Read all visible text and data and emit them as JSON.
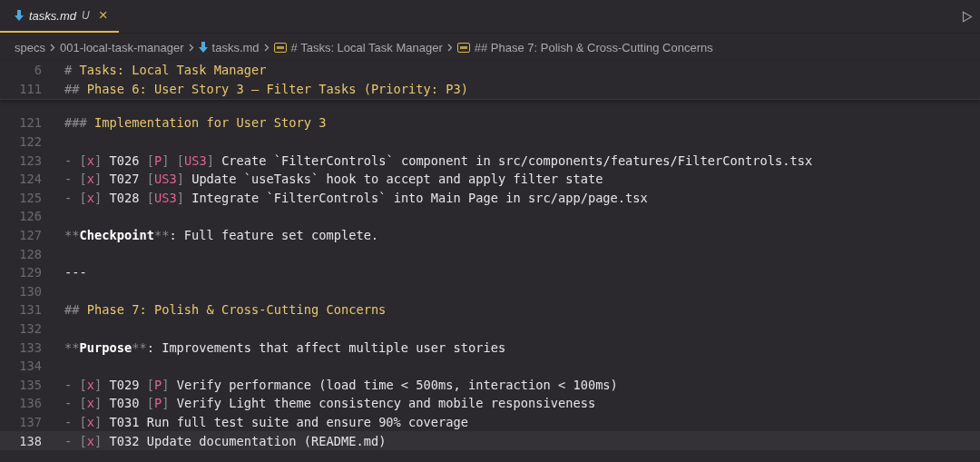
{
  "tabs": [
    {
      "label": "tasks.md",
      "status": "U",
      "close": "×",
      "selected": true
    }
  ],
  "breadcrumbs": [
    {
      "label": "specs",
      "kind": "folder"
    },
    {
      "label": "001-local-task-manager",
      "kind": "folder"
    },
    {
      "label": "tasks.md",
      "kind": "markdown"
    },
    {
      "label": "# Tasks: Local Task Manager",
      "kind": "symbol"
    },
    {
      "label": "## Phase 7: Polish & Cross-Cutting Concerns",
      "kind": "symbol"
    }
  ],
  "sticky_lines": [
    {
      "number": "6",
      "segments": [
        {
          "text": "# ",
          "kind": "muted"
        },
        {
          "text": "Tasks: Local Task Manager",
          "kind": "heading"
        }
      ]
    },
    {
      "number": "111",
      "segments": [
        {
          "text": "## ",
          "kind": "muted"
        },
        {
          "text": "Phase 6: User Story 3 – Filter Tasks (Priority: P3)",
          "kind": "heading"
        }
      ]
    }
  ],
  "lines": [
    {
      "number": "121",
      "current": false,
      "segments": [
        {
          "text": "### ",
          "kind": "muted"
        },
        {
          "text": "Implementation for User Story 3",
          "kind": "heading"
        }
      ]
    },
    {
      "number": "122",
      "current": false
    },
    {
      "number": "123",
      "current": false,
      "segments": [
        {
          "text": "- [",
          "kind": "muted"
        },
        {
          "text": "x",
          "kind": "accent"
        },
        {
          "text": "] ",
          "kind": "muted"
        },
        {
          "text": "T026 ",
          "kind": "plain"
        },
        {
          "text": "[",
          "kind": "muted"
        },
        {
          "text": "P",
          "kind": "accent"
        },
        {
          "text": "] [",
          "kind": "muted"
        },
        {
          "text": "US3",
          "kind": "accent"
        },
        {
          "text": "] ",
          "kind": "muted"
        },
        {
          "text": "Create `FilterControls` component in src/components/features/FilterControls.tsx",
          "kind": "plain"
        }
      ]
    },
    {
      "number": "124",
      "current": false,
      "segments": [
        {
          "text": "- [",
          "kind": "muted"
        },
        {
          "text": "x",
          "kind": "accent"
        },
        {
          "text": "] ",
          "kind": "muted"
        },
        {
          "text": "T027 ",
          "kind": "plain"
        },
        {
          "text": "[",
          "kind": "muted"
        },
        {
          "text": "US3",
          "kind": "accent"
        },
        {
          "text": "] ",
          "kind": "muted"
        },
        {
          "text": "Update `useTasks` hook to accept and apply filter state",
          "kind": "plain"
        }
      ]
    },
    {
      "number": "125",
      "current": false,
      "segments": [
        {
          "text": "- [",
          "kind": "muted"
        },
        {
          "text": "x",
          "kind": "accent"
        },
        {
          "text": "] ",
          "kind": "muted"
        },
        {
          "text": "T028 ",
          "kind": "plain"
        },
        {
          "text": "[",
          "kind": "muted"
        },
        {
          "text": "US3",
          "kind": "accent"
        },
        {
          "text": "] ",
          "kind": "muted"
        },
        {
          "text": "Integrate `FilterControls` into Main Page in src/app/page.tsx",
          "kind": "plain"
        }
      ]
    },
    {
      "number": "126",
      "current": false
    },
    {
      "number": "127",
      "current": false,
      "segments": [
        {
          "text": "**",
          "kind": "muted"
        },
        {
          "text": "Checkpoint",
          "kind": "strong"
        },
        {
          "text": "**",
          "kind": "muted"
        },
        {
          "text": ": Full feature set complete.",
          "kind": "plain"
        }
      ]
    },
    {
      "number": "128",
      "current": false
    },
    {
      "number": "129",
      "current": false,
      "segments": [
        {
          "text": "---",
          "kind": "plain"
        }
      ]
    },
    {
      "number": "130",
      "current": false
    },
    {
      "number": "131",
      "current": false,
      "segments": [
        {
          "text": "## ",
          "kind": "muted"
        },
        {
          "text": "Phase 7: Polish & Cross-Cutting Concerns",
          "kind": "heading"
        }
      ]
    },
    {
      "number": "132",
      "current": false
    },
    {
      "number": "133",
      "current": false,
      "segments": [
        {
          "text": "**",
          "kind": "muted"
        },
        {
          "text": "Purpose",
          "kind": "strong"
        },
        {
          "text": "**",
          "kind": "muted"
        },
        {
          "text": ": Improvements that affect multiple user stories",
          "kind": "plain"
        }
      ]
    },
    {
      "number": "134",
      "current": false
    },
    {
      "number": "135",
      "current": false,
      "segments": [
        {
          "text": "- [",
          "kind": "muted"
        },
        {
          "text": "x",
          "kind": "accent"
        },
        {
          "text": "] ",
          "kind": "muted"
        },
        {
          "text": "T029 ",
          "kind": "plain"
        },
        {
          "text": "[",
          "kind": "muted"
        },
        {
          "text": "P",
          "kind": "accent"
        },
        {
          "text": "] ",
          "kind": "muted"
        },
        {
          "text": "Verify performance (load time < 500ms, interaction < 100ms)",
          "kind": "plain"
        }
      ]
    },
    {
      "number": "136",
      "current": false,
      "segments": [
        {
          "text": "- [",
          "kind": "muted"
        },
        {
          "text": "x",
          "kind": "accent"
        },
        {
          "text": "] ",
          "kind": "muted"
        },
        {
          "text": "T030 ",
          "kind": "plain"
        },
        {
          "text": "[",
          "kind": "muted"
        },
        {
          "text": "P",
          "kind": "accent"
        },
        {
          "text": "] ",
          "kind": "muted"
        },
        {
          "text": "Verify Light theme consistency and mobile responsiveness",
          "kind": "plain"
        }
      ]
    },
    {
      "number": "137",
      "current": false,
      "segments": [
        {
          "text": "- [",
          "kind": "muted"
        },
        {
          "text": "x",
          "kind": "accent"
        },
        {
          "text": "] ",
          "kind": "muted"
        },
        {
          "text": "T031 Run full test suite and ensure 90% coverage",
          "kind": "plain"
        }
      ]
    },
    {
      "number": "138",
      "current": true,
      "segments": [
        {
          "text": "- [",
          "kind": "muted"
        },
        {
          "text": "x",
          "kind": "accent"
        },
        {
          "text": "] ",
          "kind": "muted"
        },
        {
          "text": "T032 Update documentation (README.md)",
          "kind": "plain"
        }
      ]
    }
  ]
}
